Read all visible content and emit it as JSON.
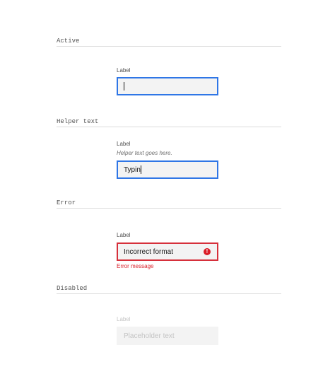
{
  "sections": {
    "active": {
      "title": "Active",
      "label": "Label",
      "value": ""
    },
    "helper": {
      "title": "Helper text",
      "label": "Label",
      "helper_text": "Helper text goes here.",
      "value": "Typin"
    },
    "error": {
      "title": "Error",
      "label": "Label",
      "value": "Incorrect format",
      "error_icon": "!",
      "error_message": "Error message"
    },
    "disabled": {
      "title": "Disabled",
      "label": "Label",
      "placeholder": "Placeholder text"
    }
  },
  "colors": {
    "focus": "#2f76e6",
    "error": "#da1e28"
  }
}
